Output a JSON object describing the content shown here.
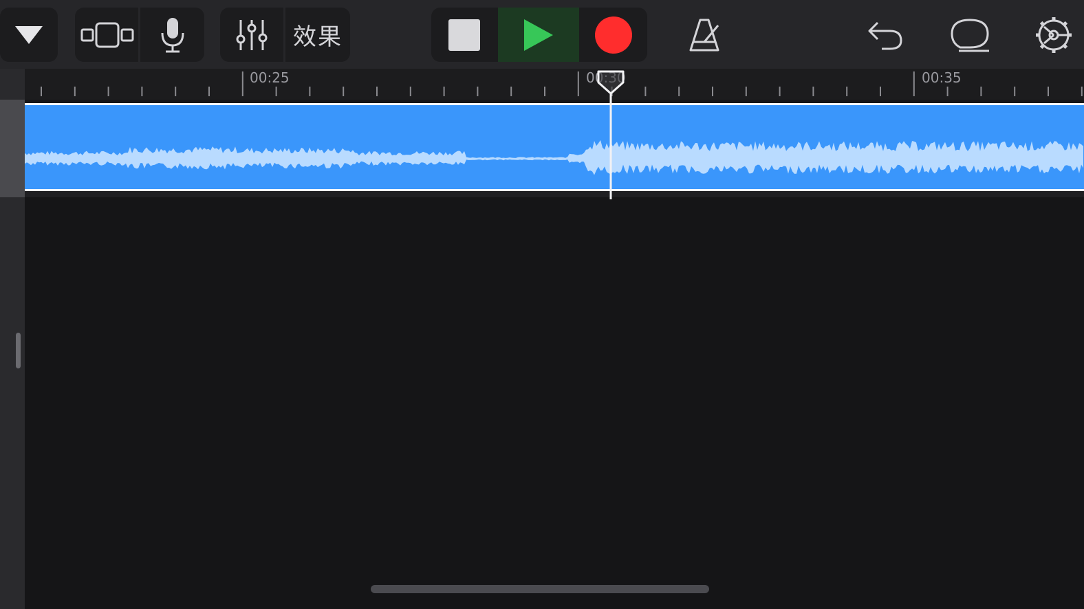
{
  "toolbar": {
    "tracks_menu": {
      "icon": "triangle-down-icon"
    },
    "view_toggle": {
      "icon": "track-view-icon"
    },
    "instrument": {
      "icon": "microphone-icon"
    },
    "controls": {
      "icon": "sliders-icon"
    },
    "effects_label": "效果",
    "transport": {
      "stop": {
        "icon": "stop-icon"
      },
      "play": {
        "icon": "play-icon",
        "color": "#37c758"
      },
      "record": {
        "icon": "record-icon",
        "color": "#ff2d2d"
      }
    },
    "metronome": {
      "icon": "metronome-icon"
    },
    "undo": {
      "icon": "undo-icon"
    },
    "loop_browser": {
      "icon": "loop-icon"
    },
    "settings": {
      "icon": "gear-icon"
    }
  },
  "ruler": {
    "labels": [
      "00:25",
      "00:30",
      "00:35"
    ]
  },
  "region": {
    "color": "#3a96fb",
    "waveform_color": "#b9dbff"
  },
  "playhead": {
    "time": "00:30"
  }
}
